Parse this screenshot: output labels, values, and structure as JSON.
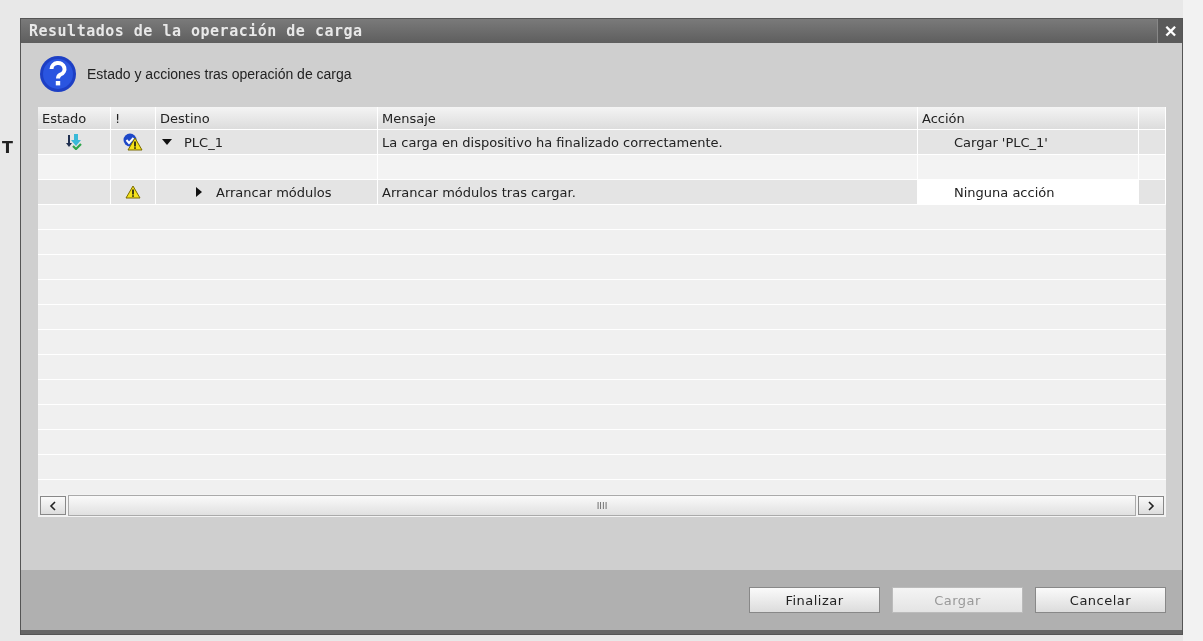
{
  "background_fragments": [
    "T"
  ],
  "dialog": {
    "title": "Resultados de la operación de carga",
    "close": "✕",
    "heading": "Estado y acciones tras operación de carga"
  },
  "table": {
    "columns": [
      "Estado",
      "!",
      "Destino",
      "Mensaje",
      "Acción"
    ],
    "rows": [
      {
        "loaded": true,
        "verified": true,
        "warning": true,
        "target": "PLC_1",
        "expanded": true,
        "message": "La carga en dispositivo ha finalizado correctamente.",
        "action": "Cargar 'PLC_1'",
        "editable": false,
        "children": [
          {
            "loaded": false,
            "verified": false,
            "warning": true,
            "target": "Arrancar módulos",
            "expanded": false,
            "message": "Arrancar módulos tras cargar.",
            "action": "Ninguna acción",
            "editable": true
          }
        ]
      }
    ]
  },
  "scrollbar": {
    "thumb": "IIII"
  },
  "buttons": [
    {
      "label": "Finalizar",
      "disabled": false
    },
    {
      "label": "Cargar",
      "disabled": true
    },
    {
      "label": "Cancelar",
      "disabled": false
    }
  ]
}
